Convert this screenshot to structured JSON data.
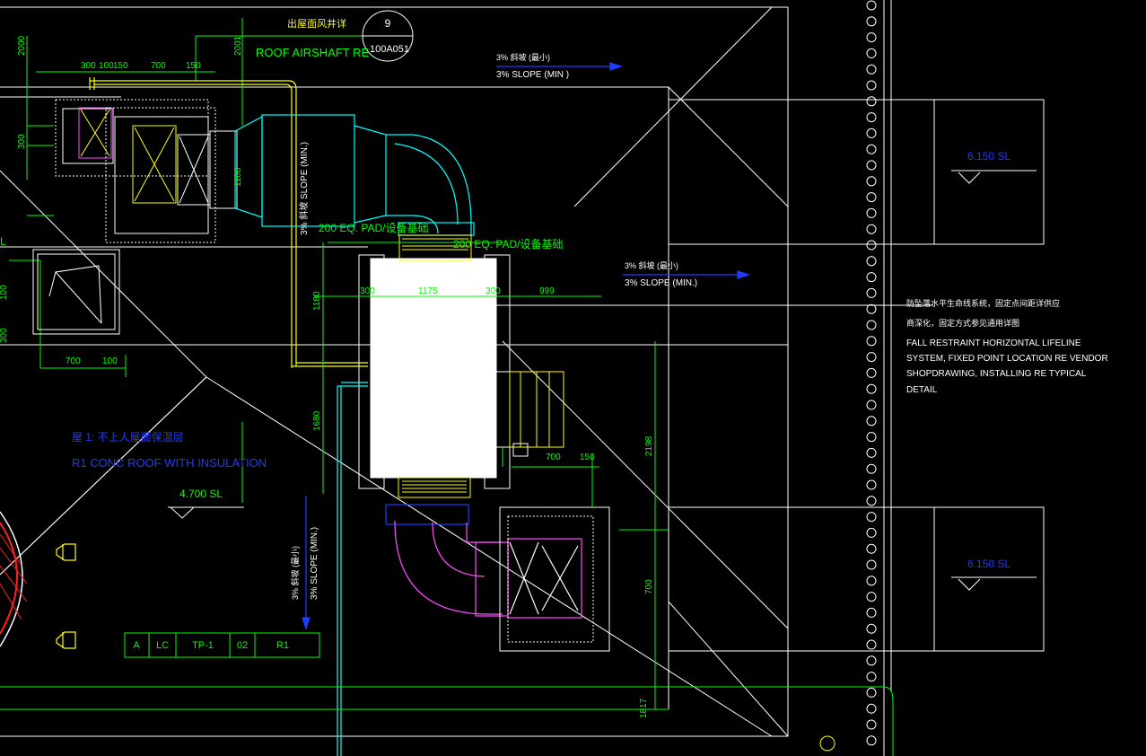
{
  "colors": {
    "background": "#000000",
    "white": "#ffffff",
    "green": "#00ff00",
    "yellow": "#ffff00",
    "cyan": "#00ffff",
    "blue": "#1e3cff",
    "magenta": "#ff4dff",
    "red": "#ff2020",
    "gray": "#bdbdbd"
  },
  "labels": {
    "airshaft_cn": "出屋面风井详",
    "airshaft_en": "ROOF AIRSHAFT RE",
    "bubble_top": "9",
    "bubble_bottom": "100A051",
    "slope_top_cn": "3% 斜坡     (最小)",
    "slope_top_en": "3% SLOPE (MIN )",
    "slope_mid_cn": "3% 斜坡     (最小)",
    "slope_mid_en": "3% SLOPE (MIN.)",
    "slope_vert_upper": "3% 斜坡 SLOPE (MIN.)",
    "slope_vert_lower_cn": "3% 斜坡     (最小)",
    "slope_vert_lower_en": "3% SLOPE (MIN.)",
    "pad1": "200 EQ. PAD/设备基础",
    "pad2": "200 EQ. PAD/设备基础",
    "level_left": "4.700 SL",
    "level_right_top": "6.150 SL",
    "level_right_bottom": "6.150 SL",
    "roof_cn": "屋 1: 不上人屋面保温层",
    "roof_en": "R1 CONC ROOF WITH INSULATION",
    "note_cn1": "防坠落水平生命线系统，固定点间距详供应",
    "note_cn2": "商深化，固定方式参见通用详图",
    "note_en1": "FALL RESTRAINT HORIZONTAL LIFELINE",
    "note_en2": "SYSTEM, FIXED POINT LOCATION RE VENDOR",
    "note_en3": "SHOPDRAWING, INSTALLING RE TYPICAL",
    "note_en4": "DETAIL",
    "left_edge_letter": "L"
  },
  "dimensions": {
    "d2000": "2000",
    "d2001": "2001",
    "d300a": "300",
    "d100": "100",
    "d150a": "150",
    "d700a": "700",
    "d150b": "150",
    "d300v": "300",
    "d1100": "1100",
    "d1180": "1180",
    "d1680": "1680",
    "d300b": "300",
    "d1175": "1175",
    "d300c": "300",
    "d999": "999",
    "d700b": "700",
    "d150c": "150",
    "d700c": "700",
    "d100b": "100",
    "d2198": "2198",
    "d700v": "700",
    "d1817": "1817",
    "d100l": "100",
    "d300l": "300"
  },
  "tag_table": [
    "A",
    "LC",
    "TP-1",
    "02",
    "R1"
  ]
}
